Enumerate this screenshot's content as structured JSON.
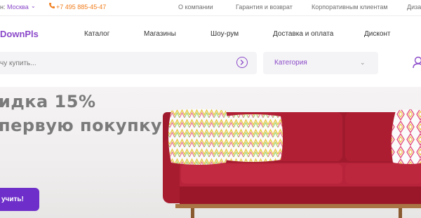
{
  "topbar": {
    "city_label": "н:",
    "city_value": "Москва",
    "phone": "+7 495 885-45-47",
    "links": [
      "О компании",
      "Гарантия и возврат",
      "Корпоративным клиентам",
      "Дизай"
    ]
  },
  "header": {
    "logo": "DownPls",
    "nav": [
      "Каталог",
      "Магазины",
      "Шоу-рум",
      "Доставка и оплата",
      "Дисконт"
    ]
  },
  "search": {
    "placeholder": "чу купить...",
    "category_label": "Категория"
  },
  "hero": {
    "title_line1": "идка 15%",
    "title_line2": "первую покупку",
    "cta_label": "учить!"
  },
  "colors": {
    "accent": "#8b49c9",
    "cta": "#6d2ec9",
    "phone": "#f07c1a",
    "sofa": "#b11f34"
  },
  "icons": {
    "city_dropdown": "chevron-down-icon",
    "phone": "phone-icon",
    "search_submit": "arrow-right-circle-icon",
    "category_dropdown": "chevron-down-icon",
    "account": "user-icon"
  }
}
